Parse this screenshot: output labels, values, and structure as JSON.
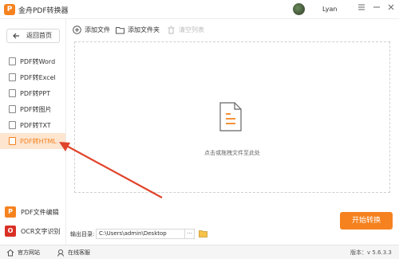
{
  "app": {
    "logo_letter": "P",
    "title": "金舟PDF转换器",
    "user_name": "Lyan",
    "window_controls": [
      "menu-icon",
      "minimize-icon",
      "close-icon"
    ]
  },
  "sidebar": {
    "back_label": "返回首页",
    "items": [
      {
        "label": "PDF转Word",
        "active": false
      },
      {
        "label": "PDF转Excel",
        "active": false
      },
      {
        "label": "PDF转PPT",
        "active": false
      },
      {
        "label": "PDF转图片",
        "active": false
      },
      {
        "label": "PDF转TXT",
        "active": false
      },
      {
        "label": "PDF转HTML",
        "active": true
      }
    ],
    "tools": [
      {
        "label": "PDF文件编辑",
        "icon_letter": "P",
        "color": "#f5821f"
      },
      {
        "label": "OCR文字识别",
        "icon_letter": "O",
        "color": "#d93025"
      }
    ]
  },
  "toolbar": {
    "add_file": "添加文件",
    "add_folder": "添加文件夹",
    "clear_list": "清空列表"
  },
  "dropzone": {
    "hint": "点击或拖拽文件至此处"
  },
  "output": {
    "label": "输出目录:",
    "path": "C:\\Users\\admin\\Desktop",
    "browse": "···"
  },
  "start_button": "开始转换",
  "statusbar": {
    "website": "官方网站",
    "support": "在线客服",
    "version": "版本：v 5.6.3.3"
  },
  "colors": {
    "accent": "#f5821f",
    "active_bg": "#fde5d0",
    "annotation_arrow": "#e0442b"
  }
}
